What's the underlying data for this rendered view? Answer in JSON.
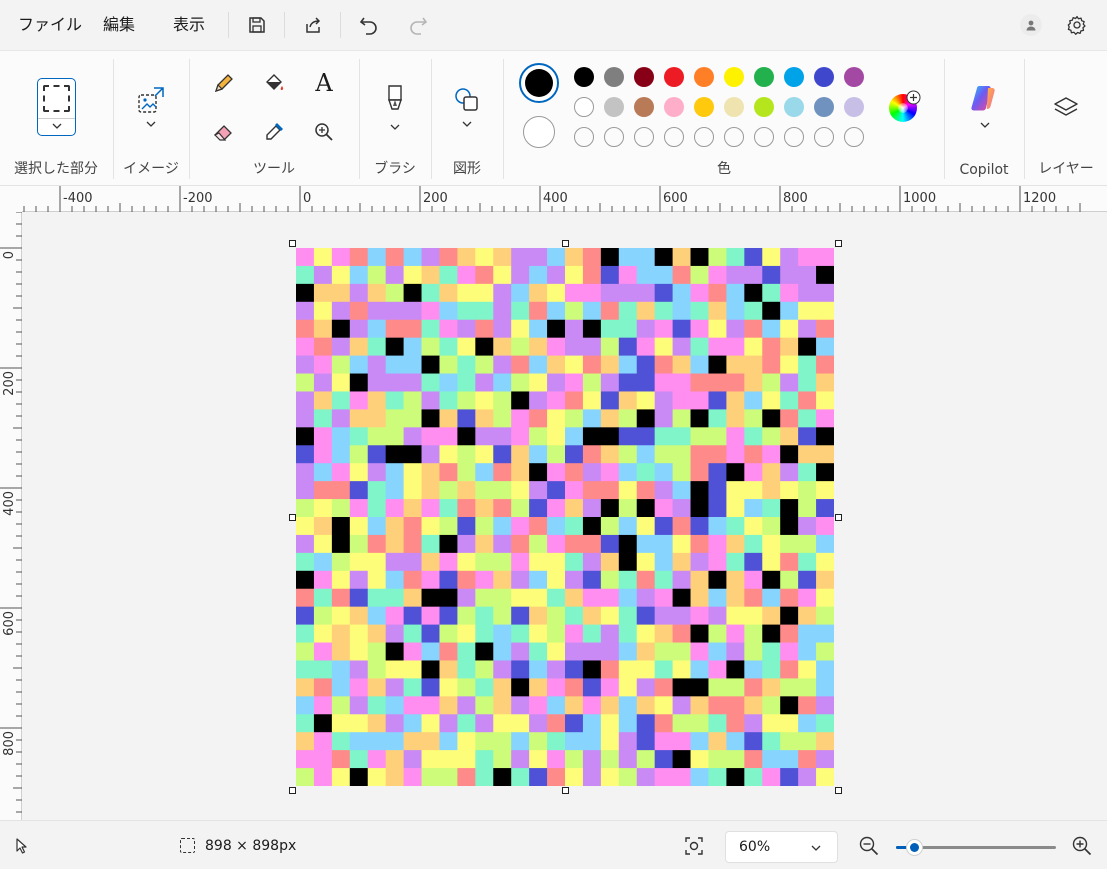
{
  "menu": {
    "file": "ファイル",
    "edit": "編集",
    "view": "表示"
  },
  "ribbon": {
    "groups": {
      "selection": "選択した部分",
      "image": "イメージ",
      "tools": "ツール",
      "brushes": "ブラシ",
      "shapes": "図形",
      "colors": "色",
      "copilot": "Copilot",
      "layers": "レイヤー"
    },
    "text_tool_glyph": "A",
    "primary_color": "#000000",
    "secondary_color": "#ffffff",
    "palette_row1": [
      "#000000",
      "#7f7f7f",
      "#880015",
      "#ed1c24",
      "#ff7f27",
      "#fff200",
      "#22b14c",
      "#00a2e8",
      "#3f48cc",
      "#a349a4"
    ],
    "palette_row2": [
      "#ffffff",
      "#c3c3c3",
      "#b97a57",
      "#ffaec9",
      "#ffc90e",
      "#efe4b0",
      "#b5e61d",
      "#99d9ea",
      "#7092be",
      "#c8bfe7"
    ],
    "palette_row3_empty_count": 10
  },
  "rulers": {
    "horizontal": [
      "-400",
      "-200",
      "0",
      "200",
      "400",
      "600",
      "800",
      "1000",
      "1200"
    ],
    "vertical": [
      "0",
      "200",
      "400",
      "600",
      "800"
    ]
  },
  "canvas": {
    "grid_cells": 30,
    "palette": [
      "#ff8ef0",
      "#7ff5c9",
      "#fdfd7a",
      "#87d4ff",
      "#cdfc7a",
      "#ff8a8a",
      "#c98af5",
      "#ffd07a",
      "#4f52d6",
      "#000000"
    ]
  },
  "status": {
    "size": "898 × 898px",
    "zoom": "60%",
    "zoom_level_fraction": 0.06
  }
}
